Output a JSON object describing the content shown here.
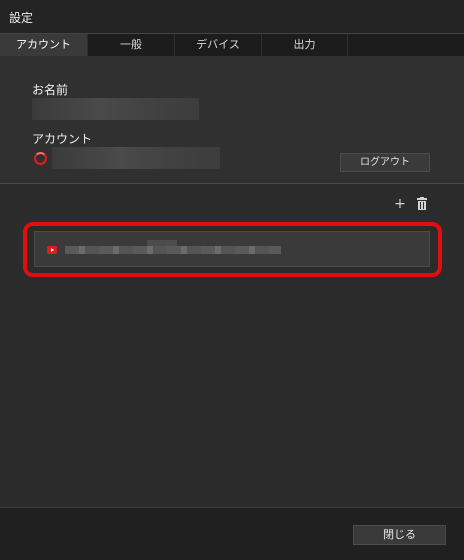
{
  "window": {
    "title": "設定"
  },
  "tabs": [
    {
      "label": "アカウント"
    },
    {
      "label": "一般"
    },
    {
      "label": "デバイス"
    },
    {
      "label": "出力"
    }
  ],
  "account": {
    "name_label": "お名前",
    "account_label": "アカウント",
    "logout_label": "ログアウト"
  },
  "toolbar": {
    "add_icon": "plus-icon",
    "delete_icon": "trash-icon"
  },
  "footer": {
    "close_label": "閉じる"
  },
  "colors": {
    "highlight": "#e20d0d",
    "youtube": "#e21c1c"
  }
}
